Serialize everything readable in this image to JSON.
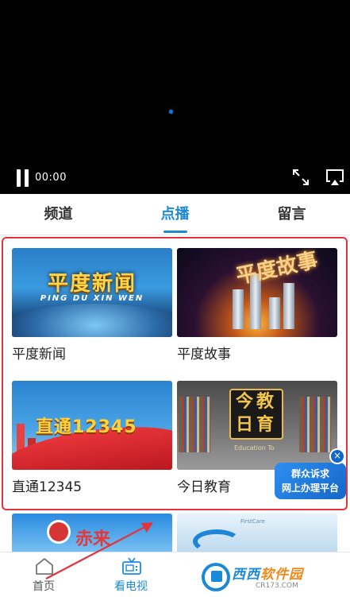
{
  "player": {
    "time": "00:00",
    "pause_icon": "pause-icon",
    "fullscreen_icon": "fullscreen-icon",
    "airplay_icon": "airplay-icon"
  },
  "tabs": [
    {
      "label": "频道",
      "active": false
    },
    {
      "label": "点播",
      "active": true
    },
    {
      "label": "留言",
      "active": false
    }
  ],
  "programs": [
    {
      "caption": "平度新闻",
      "thumb_title": "平度新闻",
      "thumb_sub": "PING DU XIN WEN"
    },
    {
      "caption": "平度故事",
      "thumb_title": "平度故事"
    },
    {
      "caption": "直通12345",
      "thumb_title": "直通12345"
    },
    {
      "caption": "今日教育",
      "thumb_title": "今教日育",
      "thumb_sub": "Education To"
    }
  ],
  "partial_programs": [
    {
      "thumb_title": "赤来"
    },
    {
      "thumb_brand": "FirstCare"
    }
  ],
  "float_ad": {
    "line1": "群众诉求",
    "line2": "网上办理平台",
    "close": "×"
  },
  "nav": [
    {
      "label": "首页",
      "icon": "home-icon",
      "active": false
    },
    {
      "label": "看电视",
      "icon": "tv-icon",
      "active": true
    }
  ],
  "watermark": {
    "brand_a": "西西",
    "brand_b": "软件园",
    "url": "CR173.COM"
  },
  "colors": {
    "accent": "#1c8ad8",
    "highlight": "#e2343a"
  }
}
